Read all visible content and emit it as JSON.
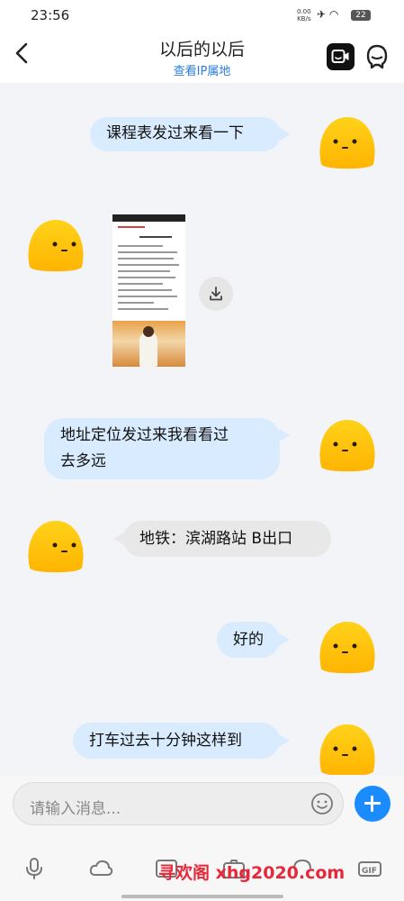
{
  "status": {
    "time": "23:56",
    "net_speed_value": "0.00",
    "net_speed_unit": "KB/s",
    "battery": "22"
  },
  "header": {
    "title": "以后的以后",
    "subtitle": "查看IP属地"
  },
  "messages": [
    {
      "side": "right",
      "type": "text",
      "text": "课程表发过来看一下"
    },
    {
      "side": "left",
      "type": "image"
    },
    {
      "side": "right",
      "type": "text",
      "line1": "地址定位发过来我看看过",
      "line2": "去多远"
    },
    {
      "side": "left",
      "type": "text",
      "text": "地铁：滨湖路站 B出口"
    },
    {
      "side": "right",
      "type": "text",
      "text": "好的"
    },
    {
      "side": "right",
      "type": "text",
      "text": "打车过去十分钟这样到"
    }
  ],
  "input": {
    "placeholder": "请输入消息..."
  },
  "watermark": "寻欢阁 xhg2020.com",
  "icons": [
    "back-icon",
    "video-call-icon",
    "profile-icon",
    "download-icon",
    "emoji-icon",
    "plus-icon",
    "mic-icon",
    "cloud-icon",
    "image-icon",
    "camera-icon",
    "voice-icon",
    "gif-icon"
  ]
}
